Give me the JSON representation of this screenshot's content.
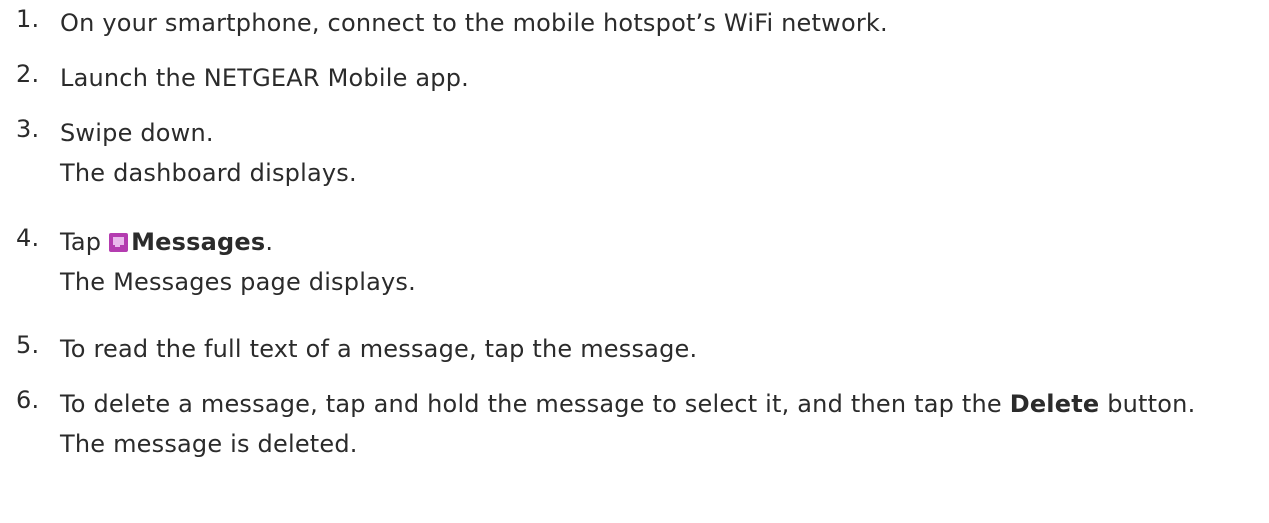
{
  "steps": [
    {
      "number": "1.",
      "text": "On your smartphone, connect to the mobile hotspot’s WiFi network."
    },
    {
      "number": "2.",
      "text": "Launch the NETGEAR Mobile app."
    },
    {
      "number": "3.",
      "text": "Swipe down.",
      "result": "The dashboard displays."
    },
    {
      "number": "4.",
      "prefix": "Tap",
      "icon": "messages-icon",
      "bold": "Messages",
      "suffix": ".",
      "result": "The Messages page displays."
    },
    {
      "number": "5.",
      "text": "To read the full text of a message, tap the message."
    },
    {
      "number": "6.",
      "text_before": "To delete a message, tap and hold the message to select it, and then tap the",
      "bold": "Delete",
      "text_after": "button.",
      "result": "The message is deleted."
    }
  ],
  "colors": {
    "text": "#2b2b2b",
    "icon_fill": "#b43cb0",
    "icon_inner": "#e9b9ec"
  }
}
